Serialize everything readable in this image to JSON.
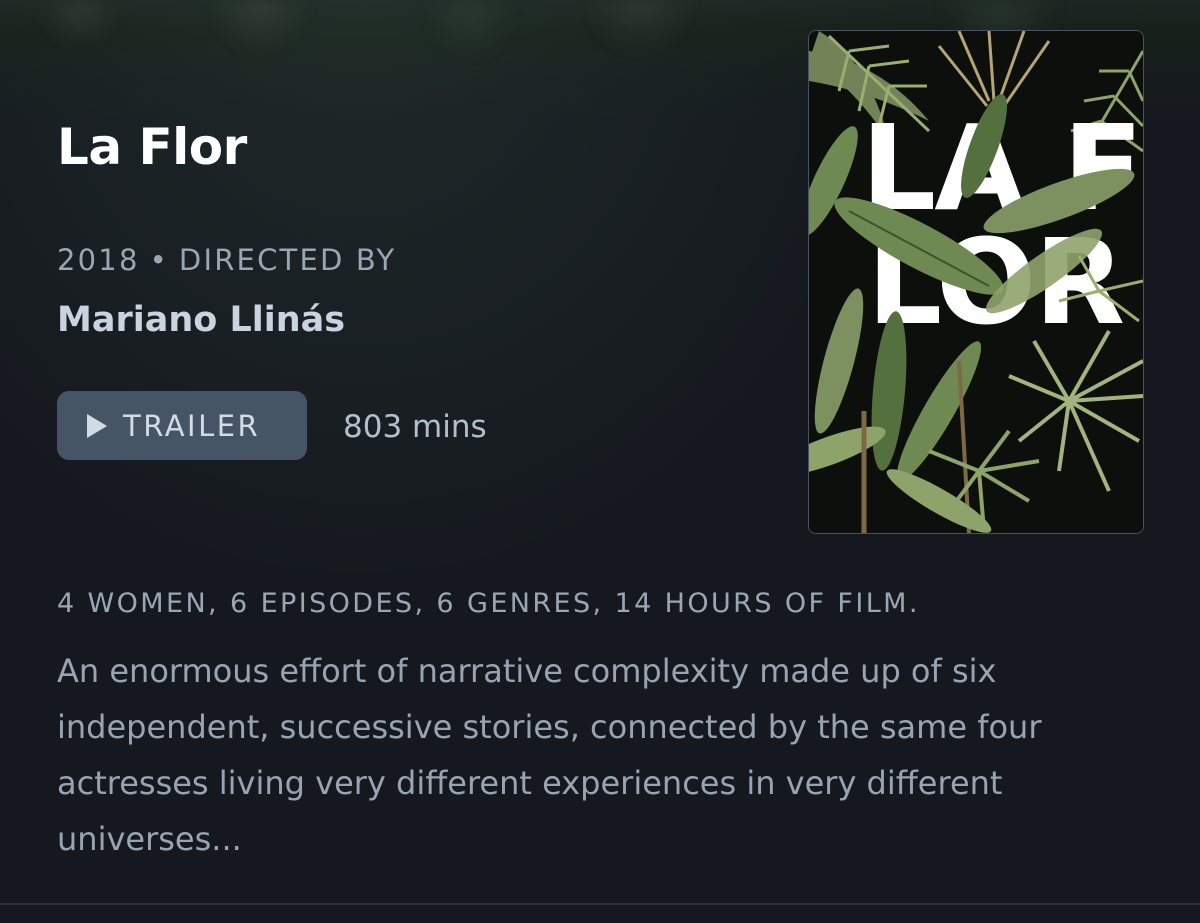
{
  "film": {
    "title": "La Flor",
    "year": "2018",
    "separator": "•",
    "directed_by_label": "DIRECTED BY",
    "director": "Mariano Llinás",
    "runtime": "803 mins",
    "tagline": "4 WOMEN, 6 EPISODES, 6 GENRES, 14 HOURS OF FILM.",
    "synopsis": "An enormous effort of narrative complexity made up of six independent, successive stories, connected by the same four actresses living very different experiences in very different universes..."
  },
  "trailer_button": {
    "label": "TRAILER",
    "icon": "play-icon"
  },
  "poster": {
    "line1": "LA F",
    "line2": "LOR",
    "background_color": "#0c0f0c",
    "leaf_colors": [
      "#6e8a52",
      "#8ea36a",
      "#55703f",
      "#b5a574",
      "#7d9160"
    ]
  },
  "colors": {
    "page_background": "#15191f",
    "title": "#ffffff",
    "meta": "#9aa6b3",
    "director": "#c9d4e0",
    "button_background": "#455566",
    "button_text": "#d3dbe4"
  }
}
